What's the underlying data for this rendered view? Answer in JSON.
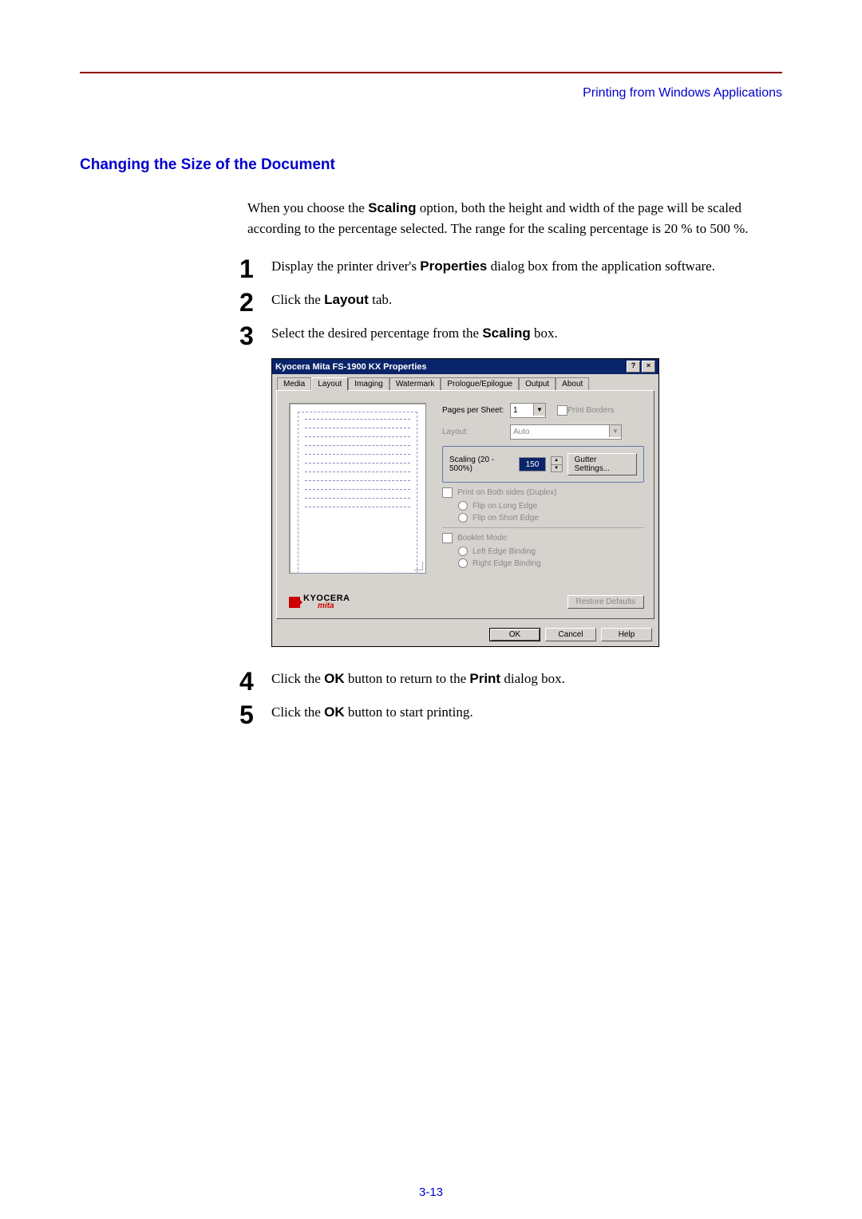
{
  "header": {
    "breadcrumb": "Printing from Windows Applications"
  },
  "section_title": "Changing the Size of the Document",
  "intro": {
    "t1": "When you choose the ",
    "b1": "Scaling",
    "t2": " option, both the height and width of the page will be scaled according to the percentage selected. The range for the scaling percentage is 20 % to 500 %."
  },
  "steps": {
    "s1": {
      "num": "1",
      "t1": "Display the printer driver's ",
      "b1": "Properties",
      "t2": " dialog box from the application software."
    },
    "s2": {
      "num": "2",
      "t1": "Click the ",
      "b1": "Layout",
      "t2": " tab."
    },
    "s3": {
      "num": "3",
      "t1": "Select the desired percentage from the ",
      "b1": "Scaling",
      "t2": " box."
    },
    "s4": {
      "num": "4",
      "t1": "Click the ",
      "b1": "OK",
      "t2": " button to return to the ",
      "b2": "Print",
      "t3": " dialog box."
    },
    "s5": {
      "num": "5",
      "t1": "Click the ",
      "b1": "OK",
      "t2": " button to start printing."
    }
  },
  "dialog": {
    "title": "Kyocera Mita FS-1900 KX Properties",
    "tabs": [
      "Media",
      "Layout",
      "Imaging",
      "Watermark",
      "Prologue/Epilogue",
      "Output",
      "About"
    ],
    "pages_per_sheet_label": "Pages per Sheet:",
    "pages_per_sheet_value": "1",
    "print_borders": "Print Borders",
    "layout_label": "Layout:",
    "layout_value": "Auto",
    "scaling_label": "Scaling (20 - 500%)",
    "scaling_value": "150",
    "gutter_settings": "Gutter Settings...",
    "duplex_label": "Print on Both sides (Duplex)",
    "flip_long": "Flip on Long Edge",
    "flip_short": "Flip on Short Edge",
    "booklet_label": "Booklet Mode:",
    "left_binding": "Left Edge Binding",
    "right_binding": "Right Edge Binding",
    "logo_text": "KYOCERA",
    "logo_sub": "mita",
    "restore": "Restore Defaults",
    "ok": "OK",
    "cancel": "Cancel",
    "help": "Help"
  },
  "page_number": "3-13"
}
